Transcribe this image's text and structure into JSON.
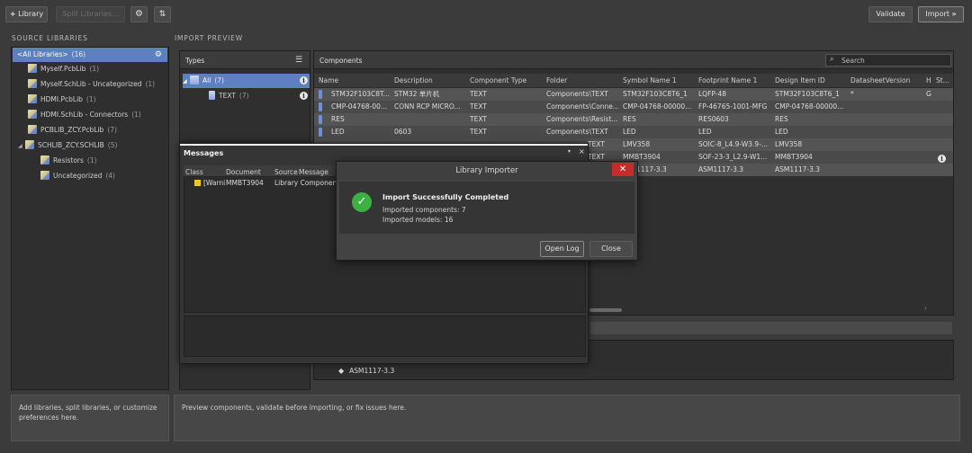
{
  "toolbar": {
    "library_label": "Library",
    "split_label": "Split Libraries...",
    "validate_label": "Validate",
    "import_label": "Import"
  },
  "source_libraries": {
    "title": "SOURCE LIBRARIES",
    "items": [
      {
        "label": "<All Libraries>",
        "count": "(16)"
      },
      {
        "label": "Myself.PcbLib",
        "count": "(1)"
      },
      {
        "label": "Myself.SchLib - Uncategorized",
        "count": "(1)"
      },
      {
        "label": "HDMI.PcbLib",
        "count": "(1)"
      },
      {
        "label": "HDMI.SchLib - Connectors",
        "count": "(1)"
      },
      {
        "label": "PCBLIB_ZCY.PcbLib",
        "count": "(7)"
      },
      {
        "label": "SCHLIB_ZCY.SCHLIB",
        "count": "(5)"
      },
      {
        "label": "Resistors",
        "count": "(1)"
      },
      {
        "label": "Uncategorized",
        "count": "(4)"
      }
    ],
    "help": "Add libraries, split libraries, or customize preferences here."
  },
  "import_preview": {
    "title": "IMPORT PREVIEW",
    "types_title": "Types",
    "types": [
      {
        "label": "All",
        "count": "(7)"
      },
      {
        "label": "TEXT",
        "count": "(7)"
      }
    ],
    "components_title": "Components",
    "search_placeholder": "Search",
    "columns": [
      "Name",
      "Description",
      "Component Type",
      "Folder",
      "Symbol Name 1",
      "Footprint Name 1",
      "Design Item ID",
      "DatasheetVersion",
      "H",
      "St..."
    ],
    "rows": [
      [
        "STM32F103C8T...",
        "STM32 单片机",
        "TEXT",
        "Components\\TEXT",
        "STM32F103C8T6_1",
        "LQFP-48",
        "STM32F103C8T6_1",
        "*",
        "G"
      ],
      [
        "CMP-04768-00...",
        "CONN RCP MICRO...",
        "TEXT",
        "Components\\Conne...",
        "CMP-04768-00000...",
        "FP-46765-1001-MFG",
        "CMP-04768-00000...",
        "",
        ""
      ],
      [
        "RES",
        "",
        "TEXT",
        "Components\\Resist...",
        "RES",
        "RES0603",
        "RES",
        "",
        ""
      ],
      [
        "LED",
        "0603",
        "TEXT",
        "Components\\TEXT",
        "LED",
        "LED",
        "LED",
        "",
        ""
      ],
      [
        "",
        "",
        "TEXT",
        "",
        "LMV358",
        "SOIC-8_L4.9-W3.9-...",
        "LMV358",
        "",
        ""
      ],
      [
        "",
        "",
        "TEXT",
        "",
        "MMBT3904",
        "SOF-23-3_L2.9-W1...",
        "MMBT3904",
        "",
        ""
      ],
      [
        "",
        "",
        "",
        "",
        "1117-3.3",
        "ASM1117-3.3",
        "ASM1117-3.3",
        "",
        ""
      ]
    ],
    "bottom_item": "ASM1117-3.3",
    "help": "Preview components, validate before importing, or fix issues here."
  },
  "messages": {
    "title": "Messages",
    "columns": [
      "Class",
      "Document",
      "Source",
      "Message"
    ],
    "row": [
      "[Warni",
      "MMBT3904",
      "Library Component"
    ]
  },
  "dialog": {
    "title": "Library Importer",
    "heading": "Import Successfully Completed",
    "line1": "Imported components: 7",
    "line2": "Imported models: 16",
    "open_log": "Open Log",
    "close": "Close"
  },
  "colors": {
    "accent": "#5f80c0",
    "success": "#3cb043",
    "close_red": "#c42b2b"
  }
}
